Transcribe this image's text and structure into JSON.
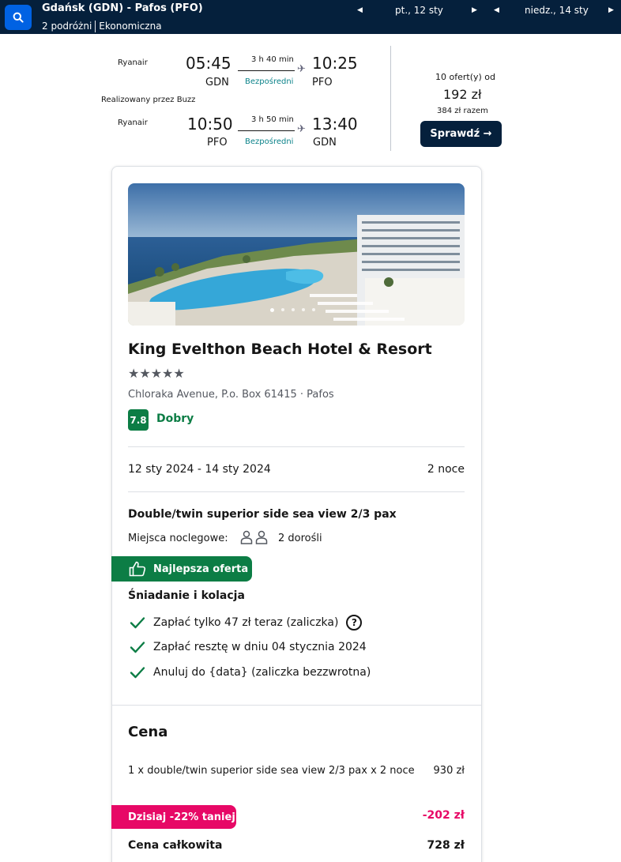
{
  "header": {
    "route": "Gdańsk (GDN) - Pafos (PFO)",
    "travellers": "2 podróżni",
    "cabin": "Ekonomiczna",
    "depart_date": "pt., 12 sty",
    "return_date": "niedz., 14 sty",
    "icons": [
      "search-icon",
      "chevron-left-icon",
      "chevron-right-icon"
    ]
  },
  "flights": {
    "outbound": {
      "airline": "Ryanair",
      "dep_time": "05:45",
      "dep_code": "GDN",
      "duration": "3 h 40 min",
      "stops": "Bezpośredni",
      "arr_time": "10:25",
      "arr_code": "PFO"
    },
    "operated_by": "Realizowany przez Buzz",
    "inbound": {
      "airline": "Ryanair",
      "dep_time": "10:50",
      "dep_code": "PFO",
      "duration": "3 h 50 min",
      "stops": "Bezpośredni",
      "arr_time": "13:40",
      "arr_code": "GDN"
    },
    "offers": "10 ofert(y) od",
    "price": "192 zł",
    "total": "384 zł razem",
    "check_label": "Sprawdź →"
  },
  "hotel": {
    "name": "King Evelthon Beach Hotel & Resort",
    "stars": "★★★★★",
    "address": "Chloraka Avenue, P.o. Box 61415 · Pafos",
    "rating": "7.8",
    "rating_label": "Dobry",
    "dates": "12 sty 2024 - 14 sty 2024",
    "nights": "2 noce",
    "room": "Double/twin superior side sea view 2/3 pax",
    "beds_label": "Miejsca noclegowe:",
    "beds_value": "2 dorośli",
    "best_offer": "Najlepsza oferta",
    "meal": "Śniadanie i kolacja",
    "features": [
      "Zapłać tylko 47 zł teraz (zaliczka)",
      "Zapłać resztę w dniu 04 stycznia 2024",
      "Anuluj do {data} (zaliczka bezzwrotna)"
    ],
    "help": "?"
  },
  "pricing": {
    "title": "Cena",
    "item": "1 x double/twin superior side sea view 2/3 pax  x 2 noce",
    "item_price": "930 zł",
    "discount_label": "Dzisiaj -22% taniej",
    "discount_value": "-202 zł",
    "total_label": "Cena całkowita",
    "total_value": "728 zł"
  },
  "colors": {
    "navy": "#05203c",
    "blue": "#0062e3",
    "green": "#0c7d45",
    "teal": "#0c838a",
    "pink": "#e70866"
  }
}
